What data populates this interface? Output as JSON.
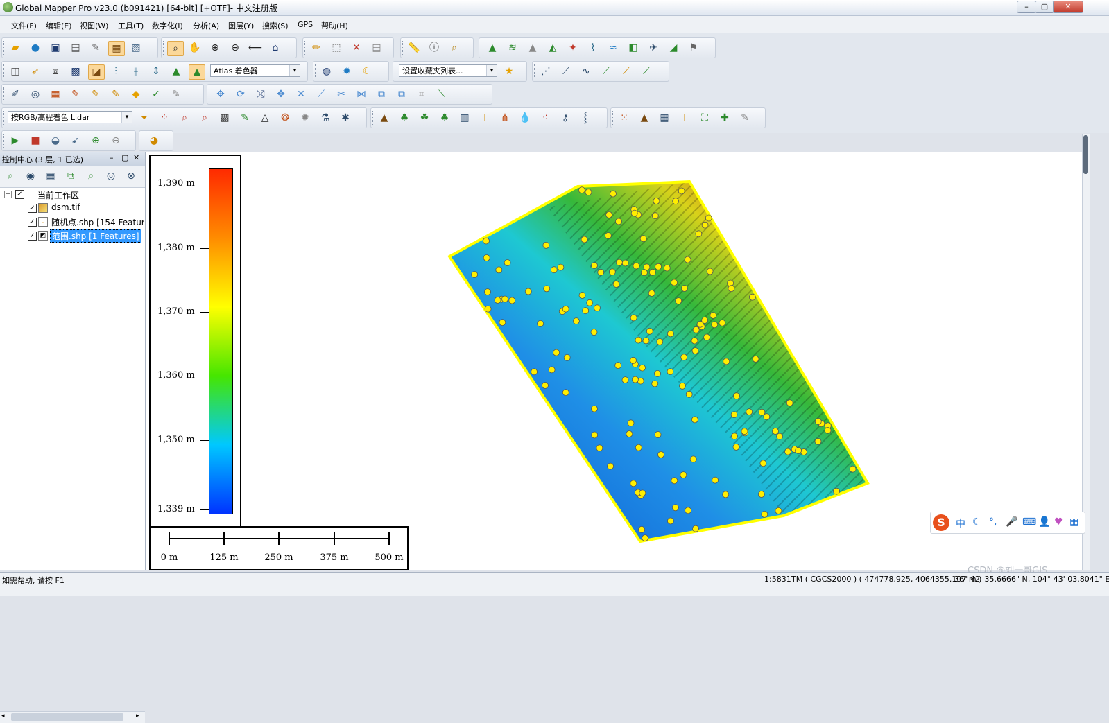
{
  "window": {
    "title": "Global Mapper Pro v23.0 (b091421) [64-bit] [+OTF]- 中文注册版",
    "controls": [
      "–",
      "▢",
      "✕"
    ]
  },
  "menu": [
    "文件(F)",
    "编辑(E)",
    "视图(W)",
    "工具(T)",
    "数字化(I)",
    "分析(A)",
    "图层(Y)",
    "搜索(S)",
    "GPS",
    "帮助(H)"
  ],
  "toolbars": {
    "shader_dropdown": "Atlas 着色器",
    "favorites_dropdown": "设置收藏夹列表...",
    "lidar_dropdown": "按RGB/高程着色 Lidar"
  },
  "control_center": {
    "title": "控制中心 (3 层, 1 已选)",
    "workspace": "当前工作区",
    "layers": [
      {
        "name": "dsm.tif",
        "checked": true,
        "selected": false
      },
      {
        "name": "随机点.shp [154 Features]",
        "checked": true,
        "selected": false
      },
      {
        "name": "范围.shp [1 Features]",
        "checked": true,
        "selected": true
      }
    ]
  },
  "legend": {
    "labels": [
      "1,390 m",
      "1,380 m",
      "1,370 m",
      "1,360 m",
      "1,350 m",
      "1,339 m"
    ],
    "colors": [
      "#ff2a00",
      "#ff8c00",
      "#ffff00",
      "#46e600",
      "#00c8ff",
      "#0033ff"
    ]
  },
  "scale_bar": {
    "labels": [
      "0 m",
      "125 m",
      "250 m",
      "375 m",
      "500 m"
    ]
  },
  "status": {
    "help": "如需帮助, 请按 F1",
    "scale": "1:5831",
    "projection": "TM ( CGCS2000 ) ( 474778.925, 4064355.107 m )",
    "geo": "36° 42' 35.6666\" N, 104° 43' 03.8041\" E"
  },
  "ime_bar": {
    "label": "中"
  },
  "watermark": "CSDN @刘一哥GIS",
  "colors": {
    "boundary": "#ffff00",
    "points": "#ffee00",
    "selection": "#3399ff"
  }
}
